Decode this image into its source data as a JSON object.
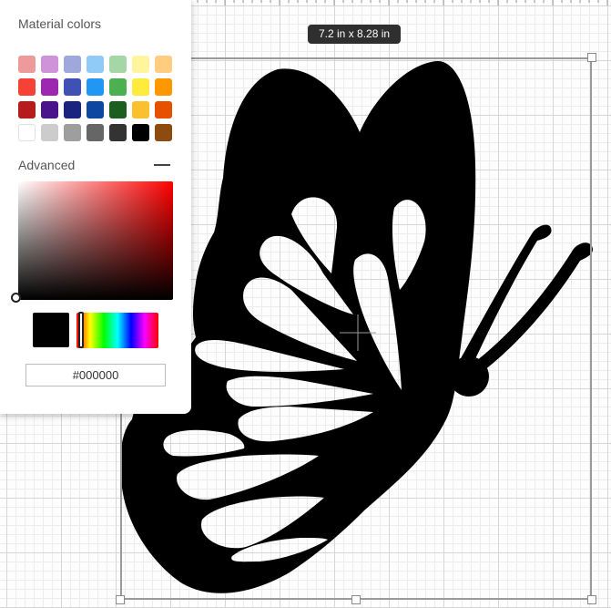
{
  "color_panel": {
    "title": "Material colors",
    "advanced_label": "Advanced",
    "hex_value": "#000000",
    "selected_color": "#000000",
    "hue_color": "#ff0000",
    "swatch_rows": [
      [
        "#ef9a9a",
        "#ce93d8",
        "#9fa8da",
        "#90caf9",
        "#a5d6a7",
        "#fff59d",
        "#ffcc80"
      ],
      [
        "#f44336",
        "#9c27b0",
        "#3f51b5",
        "#2196f3",
        "#4caf50",
        "#ffeb3b",
        "#ff9800"
      ],
      [
        "#b71c1c",
        "#4a148c",
        "#1a237e",
        "#0d47a1",
        "#1b5e20",
        "#fbc02d",
        "#e65100"
      ],
      [
        "#ffffff",
        "#cccccc",
        "#9e9e9e",
        "#666666",
        "#333333",
        "#000000",
        "#8d4b0f"
      ]
    ]
  },
  "canvas": {
    "dimension_label": "7.2  in x 8.28  in",
    "artwork_color": "#000000",
    "selection_color": "#9a9a9a"
  }
}
